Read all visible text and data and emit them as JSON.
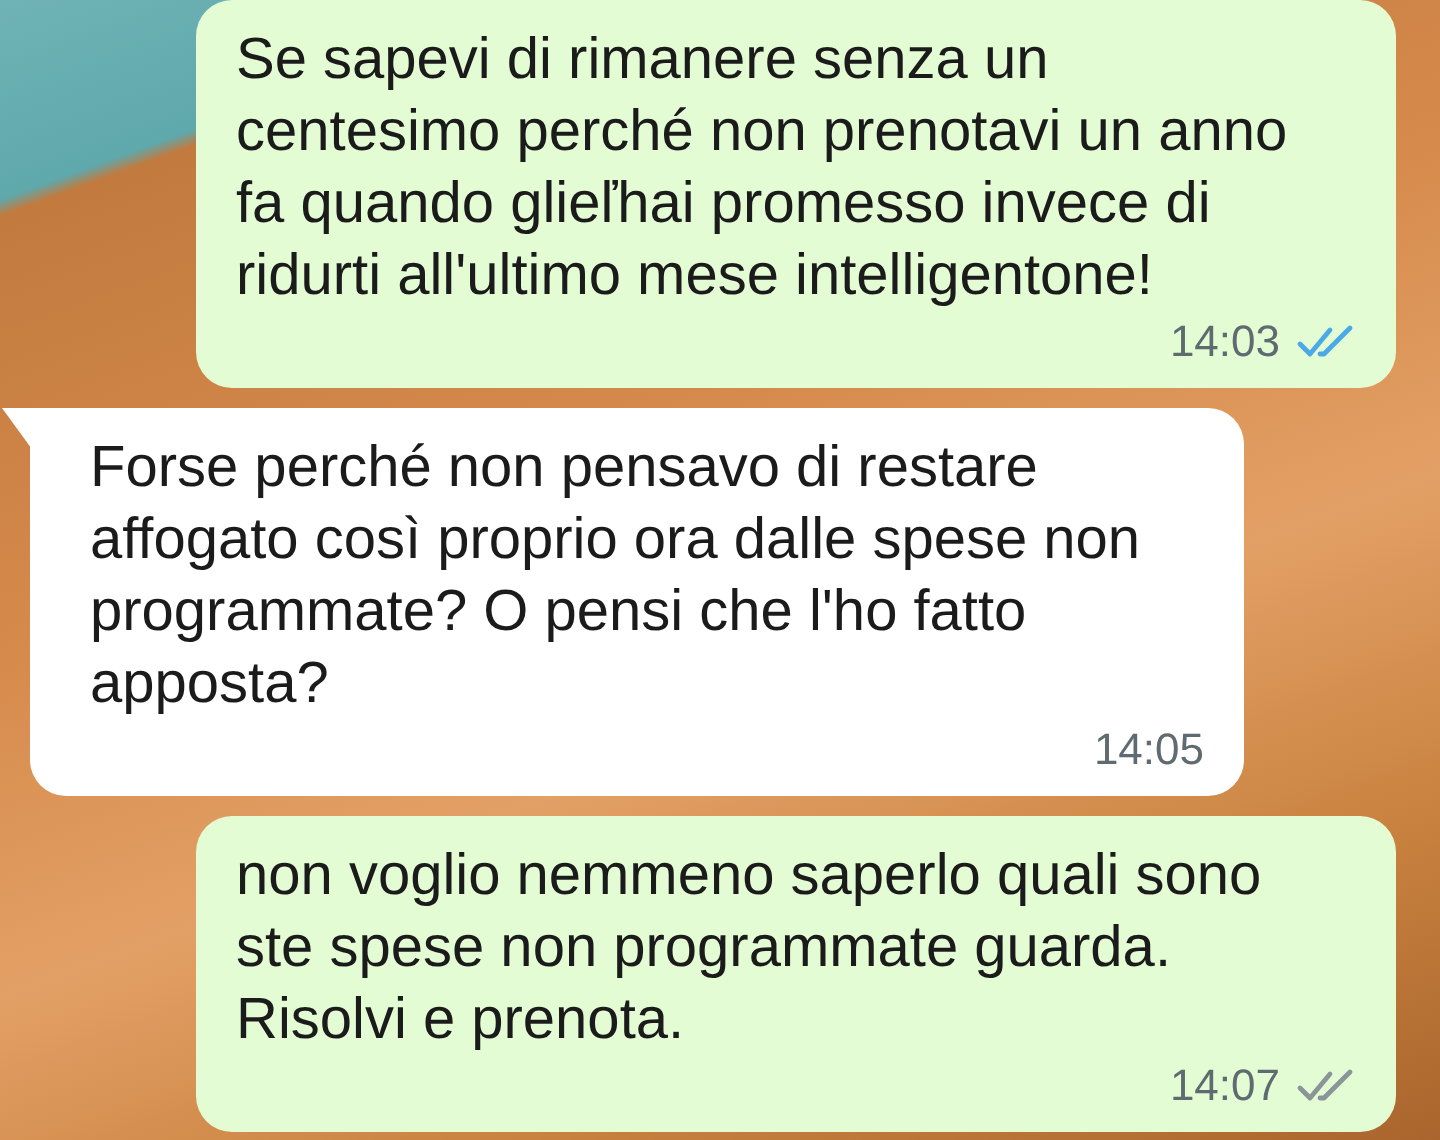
{
  "messages": [
    {
      "kind": "outgoing",
      "text": "Se sapevi di rimanere senza un centesimo perché non prenotavi un anno fa quando glieľhai promesso invece di ridurti all'ultimo mese intelligentone!",
      "time": "14:03",
      "read": true
    },
    {
      "kind": "incoming",
      "text": "Forse perché non pensavo di restare affogato così proprio ora dalle spese non programmate? O pensi che l'ho fatto apposta?",
      "time": "14:05"
    },
    {
      "kind": "outgoing",
      "text": "non voglio nemmeno saperlo quali sono ste spese non programmate guarda. Risolvi e prenota.",
      "time": "14:07",
      "read": false
    }
  ]
}
